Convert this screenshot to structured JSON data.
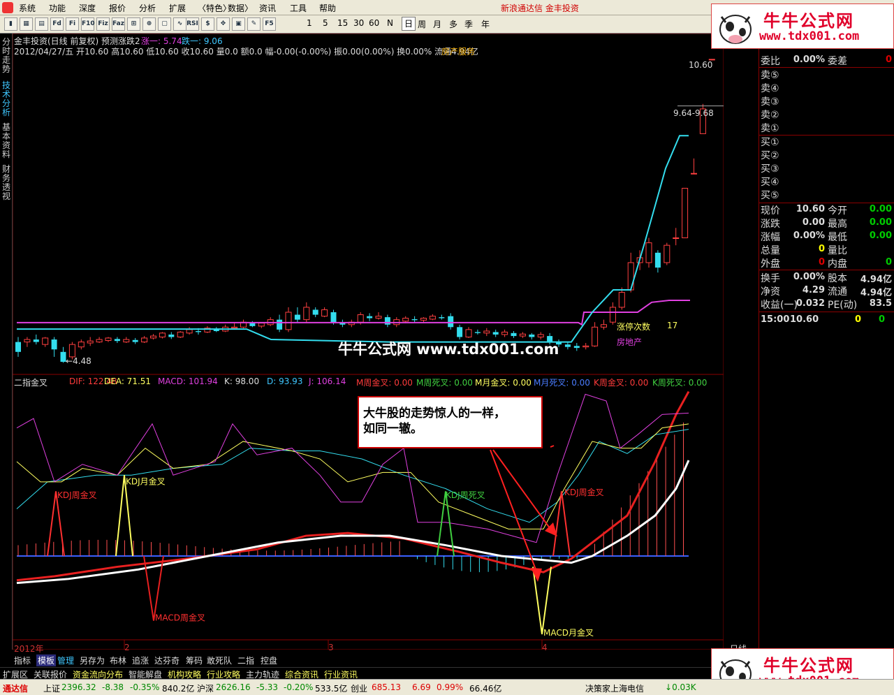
{
  "menu": [
    "系统",
    "功能",
    "深度",
    "报价",
    "分析",
    "扩展",
    "特色",
    "数据",
    "资讯",
    "工具",
    "帮助"
  ],
  "app_title": "新浪通达信  金丰投资",
  "toolbar": {
    "periods": [
      "1",
      "5",
      "15",
      "30",
      "60",
      "N",
      "日",
      "周",
      "月",
      "多",
      "季",
      "年"
    ],
    "active_period": "日",
    "icons": [
      "chart-bars-icon",
      "grid-icon",
      "table-icon",
      "fund-icon",
      "finance-icon",
      "f10-icon",
      "fiz-icon",
      "faz-icon",
      "compare-icon",
      "zoom-icon",
      "frame-icon",
      "line-chart-icon",
      "rsi-icon",
      "dollar-icon",
      "move-icon",
      "plugin-icon",
      "pen-icon",
      "f5-icon"
    ],
    "icon_labels": [
      "▮",
      "▦",
      "▤",
      "Fd",
      "Fi",
      "F10",
      "Fiz",
      "Faz",
      "⊞",
      "⊕",
      "▢",
      "∿",
      "RSI",
      "$",
      "✥",
      "▣",
      "✎",
      "F5"
    ]
  },
  "side_tabs": [
    "分时走势",
    "技术分析",
    "基本资料",
    "财务透视"
  ],
  "main_chart": {
    "title": "金丰投资(日线 前复权) 预测涨跌2",
    "up_label": "涨一: 5.74",
    "down_label": "跌一: 9.06",
    "info_line": "2012/04/27/五 开10.60 高10.60 低10.60 收10.60 量0.0 额0.0 幅-0.00(-0.00%) 振0.00(0.00%) 换0.00% 流通4.94亿",
    "sector": "房产服务",
    "y_ticks": [
      "10.50",
      "10.00",
      "9.50",
      "9.00",
      "8.50",
      "8.00",
      "7.50",
      "7.00",
      "6.50",
      "6.00",
      "5.50",
      "5.00",
      "4.50"
    ],
    "price_high_label": "10.60",
    "price_range_label": "9.64-9.68",
    "low_label": "4.48",
    "limit_up_label": "涨停次数",
    "limit_up_count": "17",
    "industry_label": "房地产"
  },
  "indicator": {
    "name": "二指金叉",
    "dif": "DIF: 122.48",
    "dea": "DEA: 71.51",
    "macd": "MACD: 101.94",
    "k": "K: 98.00",
    "d": "D: 93.93",
    "j": "J: 106.14",
    "m_week_gold": "M周金叉: 0.00",
    "m_week_dead": "M周死叉: 0.00",
    "m_month_gold": "M月金叉: 0.00",
    "m_month_dead": "M月死叉: 0.00",
    "k_week_gold": "K周金叉: 0.00",
    "k_week_dead": "K周死叉: 0.00",
    "y_ticks": [
      "120.0",
      "100.0",
      "80.00",
      "60.00",
      "40.00",
      "20.00",
      "0.00",
      "-20.00",
      "-40.00"
    ],
    "annotations": [
      "KDJ周金叉",
      "KDJ月金叉",
      "MACD周金叉",
      "KDJ周死叉",
      "KDJ周金叉",
      "MACD月金叉"
    ]
  },
  "time_axis": [
    "2012年",
    "2",
    "3",
    "4"
  ],
  "annotation_box": [
    "大牛股的走势惊人的一样，",
    "如同一辙。"
  ],
  "watermark": "牛牛公式网  www.tdx001.com",
  "logo": {
    "title": "牛牛公式网",
    "url": "www.tdx001.com"
  },
  "right_panel": {
    "header": "委比",
    "weibi": "0.00%",
    "weicha_label": "委差",
    "weicha": "0",
    "sells": [
      "卖⑤",
      "卖④",
      "卖③",
      "卖②",
      "卖①"
    ],
    "buys": [
      "买①",
      "买②",
      "买③",
      "买④",
      "买⑤"
    ],
    "quotes": [
      {
        "l1": "现价",
        "v1": "10.60",
        "l2": "今开",
        "v2": "0.00"
      },
      {
        "l1": "涨跌",
        "v1": "0.00",
        "l2": "最高",
        "v2": "0.00"
      },
      {
        "l1": "涨幅",
        "v1": "0.00%",
        "l2": "最低",
        "v2": "0.00"
      },
      {
        "l1": "总量",
        "v1": "0",
        "l2": "量比",
        "v2": ""
      },
      {
        "l1": "外盘",
        "v1": "0",
        "l2": "内盘",
        "v2": "0"
      },
      {
        "l1": "换手",
        "v1": "0.00%",
        "l2": "股本",
        "v2": "4.94亿"
      },
      {
        "l1": "净资",
        "v1": "4.29",
        "l2": "流通",
        "v2": "4.94亿"
      },
      {
        "l1": "收益(一)",
        "v1": "0.032",
        "l2": "PE(动)",
        "v2": "83.5"
      }
    ],
    "tick": {
      "time": "15:00",
      "price": "10.60",
      "vol": "0",
      "flag": "0"
    },
    "period_label": "日线"
  },
  "bottom_tabs": [
    "指标",
    "模板",
    "管理",
    "另存为",
    "布林",
    "追涨",
    "达芬奇",
    "筹码",
    "敢死队",
    "二指",
    "控盘"
  ],
  "nav_tabs": [
    "扩展区",
    "关联报价",
    "资金流向分布",
    "智能解盘",
    "机构攻略",
    "行业攻略",
    "主力轨迹",
    "综合资讯",
    "行业资讯"
  ],
  "status": {
    "brand": "通达信",
    "sh_name": "上证",
    "sh_val": "2396.32",
    "sh_chg": "-8.38",
    "sh_pct": "-0.35%",
    "sh_amt": "840.2亿",
    "sz_name": "沪深",
    "sz_val": "2626.16",
    "sz_chg": "-5.33",
    "sz_pct": "-0.20%",
    "sz_amt": "533.5亿",
    "cy_name": "创业",
    "cy_val": "685.13",
    "cy_chg": "6.69",
    "cy_pct": "0.99%",
    "cy_amt": "66.46亿",
    "broker": "决策家上海电信",
    "speed": "0.03K"
  }
}
